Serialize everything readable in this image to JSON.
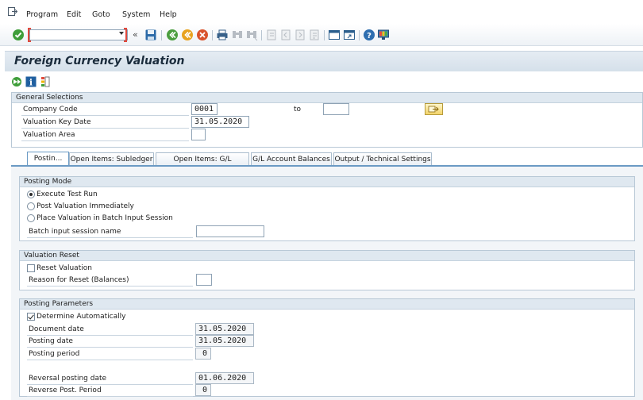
{
  "menu": {
    "items": [
      "Program",
      "Edit",
      "Goto",
      "System",
      "Help"
    ]
  },
  "toolbar": {
    "command_value": "",
    "icons": [
      "check-icon",
      "save-icon",
      "back-icon",
      "exit-icon",
      "cancel-icon",
      "print-icon",
      "find-icon",
      "find-next-icon",
      "first-page-icon",
      "prev-page-icon",
      "next-page-icon",
      "last-page-icon",
      "new-session-icon",
      "shortcut-icon",
      "help-icon",
      "customize-icon"
    ]
  },
  "title": "Foreign Currency Valuation",
  "general": {
    "header": "General Selections",
    "company_code_label": "Company Code",
    "company_code_value": "0001",
    "to_label": "to",
    "company_code_to_value": "",
    "valuation_key_date_label": "Valuation Key Date",
    "valuation_key_date_value": "31.05.2020",
    "valuation_area_label": "Valuation Area",
    "valuation_area_value": ""
  },
  "tabs": [
    {
      "label": "Postin...",
      "active": true
    },
    {
      "label": "Open Items: Subledger",
      "active": false
    },
    {
      "label": "Open Items: G/L Accounts",
      "active": false
    },
    {
      "label": "G/L Account Balances",
      "active": false
    },
    {
      "label": "Output / Technical Settings",
      "active": false
    }
  ],
  "posting_mode": {
    "header": "Posting Mode",
    "options": [
      {
        "label": "Execute Test Run",
        "selected": true
      },
      {
        "label": "Post Valuation Immediately",
        "selected": false
      },
      {
        "label": "Place Valuation in Batch Input Session",
        "selected": false
      }
    ],
    "batch_label": "Batch input session name",
    "batch_value": ""
  },
  "valuation_reset": {
    "header": "Valuation Reset",
    "reset_label": "Reset Valuation",
    "reset_checked": false,
    "reason_label": "Reason for Reset (Balances)",
    "reason_value": ""
  },
  "posting_params": {
    "header": "Posting Parameters",
    "determine_label": "Determine Automatically",
    "determine_checked": true,
    "document_date_label": "Document date",
    "document_date_value": "31.05.2020",
    "posting_date_label": "Posting date",
    "posting_date_value": "31.05.2020",
    "posting_period_label": "Posting period",
    "posting_period_value": "0",
    "reversal_date_label": "Reversal posting date",
    "reversal_date_value": "01.06.2020",
    "reverse_period_label": "Reverse Post. Period",
    "reverse_period_value": "0"
  },
  "colors": {
    "accent": "#6b9ac4",
    "header_bg": "#dfe8f0",
    "panel_bg": "#f2f5f8"
  }
}
